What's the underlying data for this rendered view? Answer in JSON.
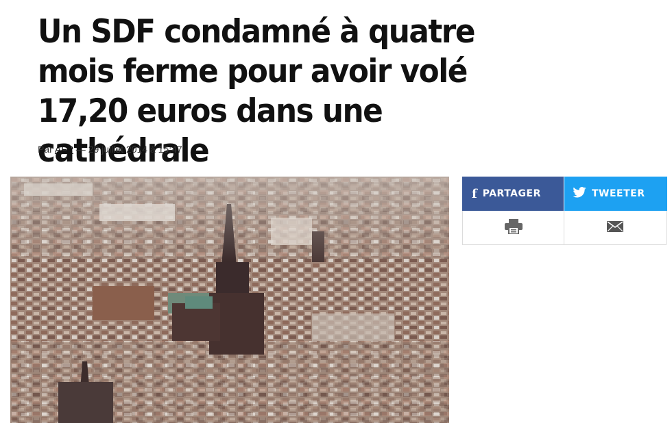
{
  "article": {
    "title": "Un SDF condamné à quatre mois ferme pour avoir volé 17,20 euros dans une cathédrale",
    "byline": {
      "prefix": "Par",
      "author": "AFP",
      "separator": "—",
      "date": "29 juillet 2014 à 15:47"
    }
  },
  "share": {
    "facebook_label": "PARTAGER",
    "twitter_label": "TWEETER",
    "facebook_color": "#3b5998",
    "twitter_color": "#1da1f2",
    "print_icon": "print-icon",
    "mail_icon": "mail-icon"
  },
  "photo": {
    "subject": "aerial view of a city with a cathedral"
  }
}
